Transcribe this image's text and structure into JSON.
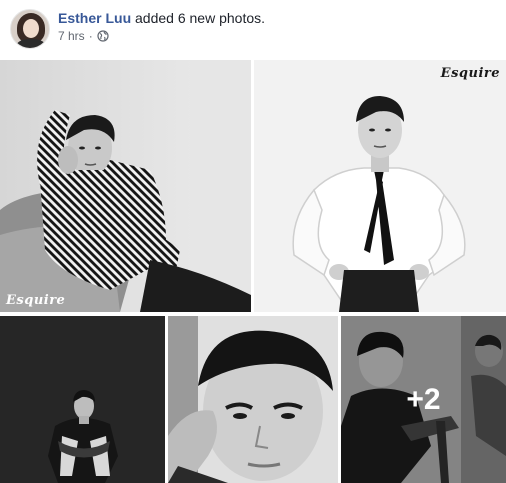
{
  "post": {
    "author": "Esther Luu",
    "action": "added 6 new photos.",
    "time": "7 hrs",
    "separator": "·",
    "privacy_icon": "globe-icon"
  },
  "photos": [
    {
      "alt": "Photo 1",
      "watermark": "Esquire"
    },
    {
      "alt": "Photo 2",
      "watermark": "Esquire"
    },
    {
      "alt": "Photo 3"
    },
    {
      "alt": "Photo 4"
    },
    {
      "alt": "Photo 5",
      "more_count": "+2"
    }
  ],
  "colors": {
    "link": "#385898",
    "text": "#1d2129",
    "meta": "#616770"
  }
}
